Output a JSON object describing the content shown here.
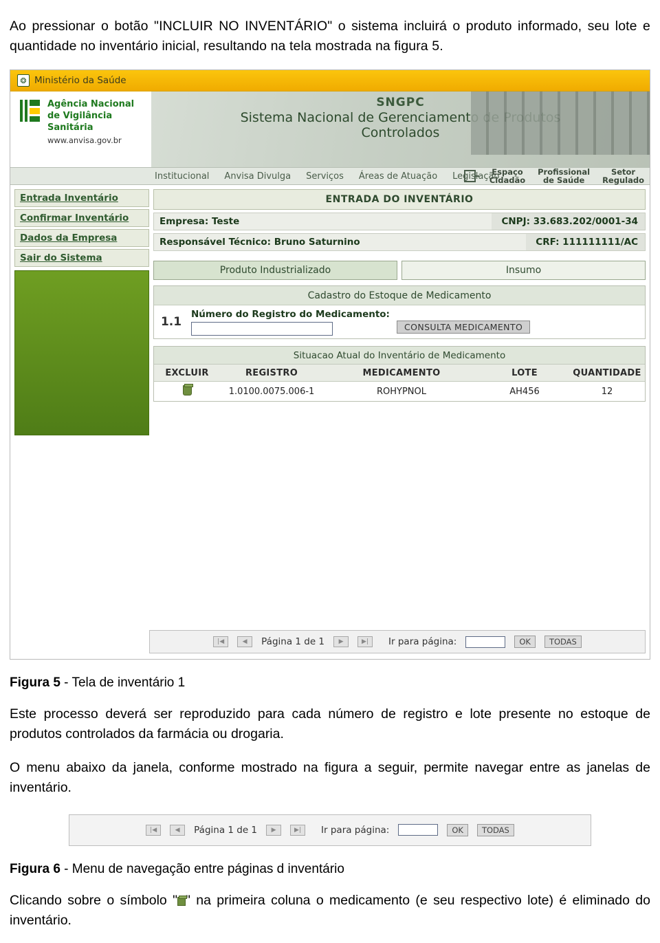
{
  "intro": "Ao pressionar o botão \"INCLUIR NO INVENTÁRIO\" o sistema incluirá o produto informado, seu lote e quantidade no inventário inicial, resultando na tela mostrada na figura 5.",
  "screenshot": {
    "ministry_bar": {
      "label": "Ministério da Saúde",
      "icon": "ministry-icon"
    },
    "header": {
      "agency_line1": "Agência Nacional",
      "agency_line2": "de Vigilância Sanitária",
      "url": "www.anvisa.gov.br",
      "system_acronym": "SNGPC",
      "system_name": "Sistema Nacional de Gerenciamento de Produtos",
      "system_name2": "Controlados"
    },
    "nav": {
      "items": [
        "Institucional",
        "Anvisa Divulga",
        "Serviços",
        "Áreas de Atuação",
        "Legislação"
      ],
      "right": [
        {
          "line1": "Espaço",
          "line2": "Cidadão"
        },
        {
          "line1": "Profissional",
          "line2": "de Saúde"
        },
        {
          "line1": "Setor",
          "line2": "Regulado"
        }
      ]
    },
    "sidebar": {
      "items": [
        "Entrada Inventário",
        "Confirmar Inventário",
        "Dados da Empresa",
        "Sair do Sistema"
      ]
    },
    "content": {
      "title": "ENTRADA DO INVENTÁRIO",
      "company_label": "Empresa:",
      "company_value": "Teste",
      "cnpj_label": "CNPJ:",
      "cnpj_value": "33.683.202/0001-34",
      "tech_label": "Responsável Técnico:",
      "tech_value": "Bruno Saturnino",
      "crf_label": "CRF:",
      "crf_value": "111111111/AC",
      "tabs": [
        {
          "label": "Produto Industrializado",
          "active": true
        },
        {
          "label": "Insumo",
          "active": false
        }
      ],
      "register_panel": {
        "title": "Cadastro do Estoque de Medicamento",
        "step": "1.1",
        "field_label": "Número do Registro do Medicamento:",
        "field_value": "",
        "button": "CONSULTA MEDICAMENTO"
      },
      "table": {
        "title": "Situacao Atual do Inventário de Medicamento",
        "columns": [
          "EXCLUIR",
          "REGISTRO",
          "MEDICAMENTO",
          "LOTE",
          "QUANTIDADE"
        ],
        "rows": [
          {
            "delete_icon": "trash-icon",
            "registro": "1.0100.0075.006-1",
            "medicamento": "ROHYPNOL",
            "lote": "AH456",
            "quantidade": "12"
          }
        ]
      },
      "pager": {
        "first": "|◀",
        "prev": "◀",
        "page_text": "Página 1 de 1",
        "next": "▶",
        "last": "▶|",
        "goto_label": "Ir para página:",
        "goto_value": "",
        "ok": "OK",
        "all": "TODAS"
      }
    }
  },
  "figure5_caption_label": "Figura 5",
  "figure5_caption_text": " - Tela de inventário 1",
  "para1": "Este processo deverá ser reproduzido para cada número de registro e lote presente no estoque de produtos controlados da farmácia ou drogaria.",
  "para2": "O menu abaixo da janela, conforme mostrado na figura a seguir, permite navegar entre as janelas de inventário.",
  "figure6_caption_label": "Figura 6",
  "figure6_caption_text": " - Menu de navegação entre páginas d inventário",
  "para3_pre": "Clicando sobre o símbolo \"",
  "para3_post": "\" na primeira coluna o medicamento (e seu respectivo lote) é eliminado do inventário."
}
